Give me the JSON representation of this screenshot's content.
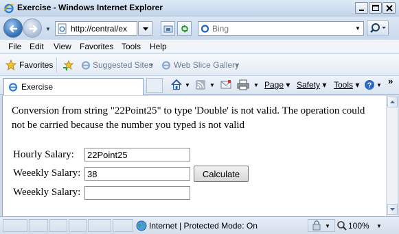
{
  "window": {
    "title": "Exercise - Windows Internet Explorer"
  },
  "address": {
    "url": "http://central/ex"
  },
  "search": {
    "placeholder": "Bing"
  },
  "menu": [
    "File",
    "Edit",
    "View",
    "Favorites",
    "Tools",
    "Help"
  ],
  "favorites_bar": {
    "favorites_label": "Favorites",
    "suggested_sites": "Suggested Sites",
    "web_slice_gallery": "Web Slice Gallery"
  },
  "tab": {
    "label": "Exercise"
  },
  "commands": {
    "page": "Page",
    "safety": "Safety",
    "tools": "Tools"
  },
  "content": {
    "message": "Conversion from string \"22Point25\" to type 'Double' is not valid. The operation could not be carried because the number you typed is not valid",
    "hourly_label": "Hourly Salary:",
    "hourly_value": "22Point25",
    "weekly_label_1": "Weeekly Salary:",
    "weekly_value_1": "38",
    "weekly_label_2": "Weeekly Salary:",
    "weekly_value_2": "",
    "calculate_label": "Calculate"
  },
  "status": {
    "zone": "Internet | Protected Mode: On",
    "zoom": "100%"
  },
  "colors": {
    "titlebar": "#c3d5ea",
    "accent": "#2e6db3"
  }
}
